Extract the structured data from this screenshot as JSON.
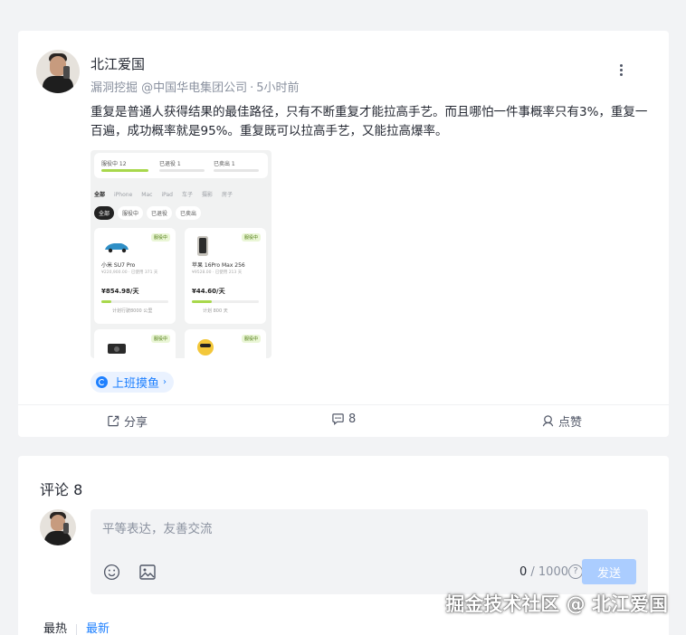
{
  "post": {
    "author": {
      "name": "北江爱国",
      "title": "漏洞挖掘 @中国华电集团公司",
      "time": "5小时前",
      "dot": "·"
    },
    "content": "重复是普通人获得结果的最佳路径，只有不断重复才能拉高手艺。而且哪怕一件事概率只有3%，重复一百遍，成功概率就是95%。重复既可以拉高手艺，又能拉高爆率。",
    "image": {
      "stats": [
        "服役中 12",
        "已退役 1",
        "已卖出 1"
      ],
      "categories": [
        "全部",
        "iPhone",
        "Mac",
        "iPad",
        "车子",
        "摄影",
        "房子"
      ],
      "filters": [
        "全部",
        "服役中",
        "已退役",
        "已卖出"
      ],
      "tiles": [
        {
          "tag": "服役中",
          "name": "小米 SU7 Pro",
          "sub": "¥220,900.00 · 已使用 371 天",
          "price": "¥854.98/天",
          "progress": 0.15,
          "note": "计划行驶8000 公里"
        },
        {
          "tag": "服役中",
          "name": "苹果 16Pro Max 256",
          "sub": "¥9528.00 · 已使用 213 天",
          "price": "¥44.60/天",
          "progress": 0.3,
          "note": "计划 800 天"
        },
        {
          "tag": "服役中"
        },
        {
          "tag": "服役中"
        }
      ]
    },
    "topic": "上班摸鱼",
    "topic_chevron": "›",
    "actions": {
      "share": "分享",
      "comment": "8",
      "like": "点赞"
    }
  },
  "comments": {
    "title": "评论 8",
    "input_placeholder": "平等表达，友善交流",
    "counter_current": "0",
    "counter_max": " / 1000",
    "help": "?",
    "send": "发送",
    "sort": {
      "hot": "最热",
      "new": "最新"
    }
  },
  "watermark": "掘金技术社区 @ 北江爱国",
  "colors": {
    "accent": "#1e80ff",
    "send_disabled": "#abcdff",
    "page_bg": "#f2f3f5"
  }
}
